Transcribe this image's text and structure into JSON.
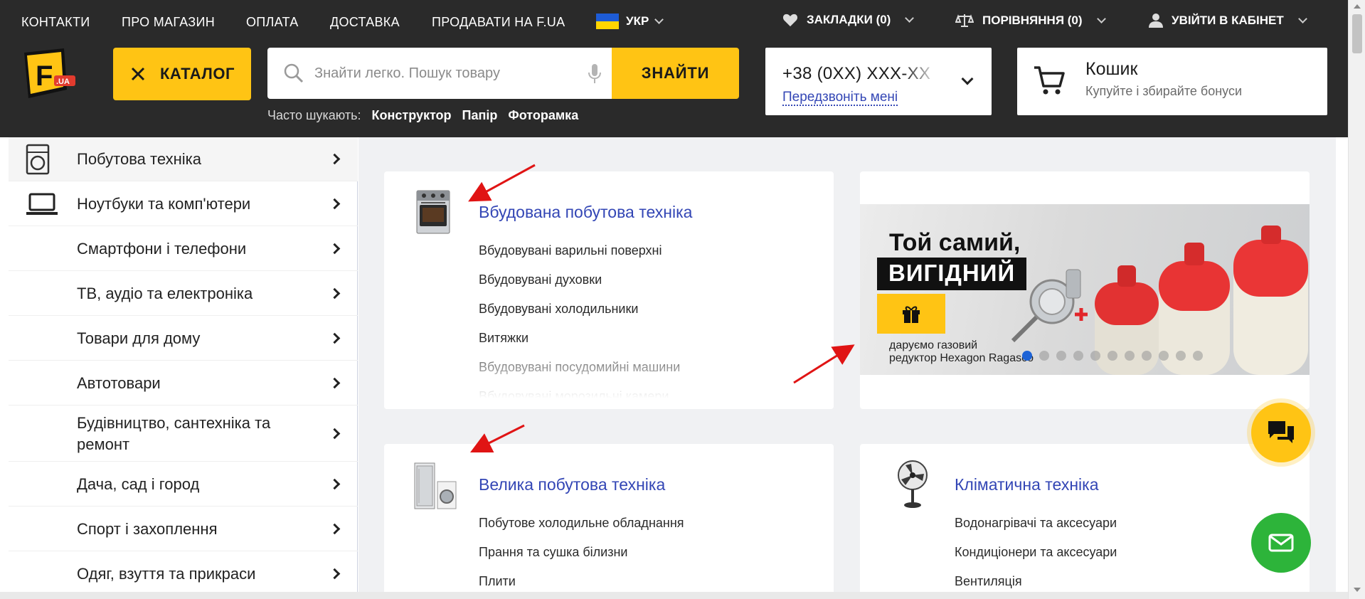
{
  "topnav": {
    "links": [
      "КОНТАКТИ",
      "ПРО МАГАЗИН",
      "ОПЛАТА",
      "ДОСТАВКА",
      "ПРОДАВАТИ НА F.UA"
    ],
    "language": "УКР",
    "bookmarks": "ЗАКЛАДКИ (0)",
    "compare": "ПОРІВНЯННЯ (0)",
    "account": "УВІЙТИ В КАБІНЕТ"
  },
  "logo": {
    "text": "F",
    "badge": ".UA"
  },
  "catalog_button": "КАТАЛОГ",
  "search": {
    "placeholder": "Знайти легко. Пошук товару",
    "button": "ЗНАЙТИ",
    "popular_label": "Часто шукають:",
    "popular_tags": [
      "Конструктор",
      "Папір",
      "Фоторамка"
    ]
  },
  "phone": {
    "number": "+38 (0XX) XXX-XX",
    "callback": "Передзвоніть мені"
  },
  "cart": {
    "title": "Кошик",
    "subtitle": "Купуйте і збирайте бонуси"
  },
  "sidebar": {
    "items": [
      {
        "label": "Побутова техніка",
        "icon": "washing-machine-icon"
      },
      {
        "label": "Ноутбуки та комп'ютери",
        "icon": "laptop-icon"
      },
      {
        "label": "Смартфони і телефони"
      },
      {
        "label": "ТВ, аудіо та електроніка"
      },
      {
        "label": "Товари для дому"
      },
      {
        "label": "Автотовари"
      },
      {
        "label": "Будівництво, сантехніка та ремонт"
      },
      {
        "label": "Дача, сад і город"
      },
      {
        "label": "Спорт і захоплення"
      },
      {
        "label": "Одяг, взуття та прикраси"
      }
    ]
  },
  "cards": {
    "builtin": {
      "title": "Вбудована побутова техніка",
      "items": [
        "Вбудовувані варильні поверхні",
        "Вбудовувані духовки",
        "Вбудовувані холодильники",
        "Витяжки",
        "Вбудовувані посудомийні машини",
        "Вбудовувані морозильні камери"
      ]
    },
    "large": {
      "title": "Велика побутова техніка",
      "items": [
        "Побутове холодильне обладнання",
        "Прання та сушка білизни",
        "Плити"
      ]
    },
    "climate": {
      "title": "Кліматична техніка",
      "items": [
        "Водонагрівачі та аксесуари",
        "Кондиціонери та аксесуари",
        "Вентиляція"
      ]
    }
  },
  "banner": {
    "line1": "Той самий,",
    "line2": "ВИГІДНИЙ",
    "sub1": "даруємо газовий",
    "sub2": "редуктор Hexagon Ragasco",
    "slides": 11,
    "active_slide": 1
  },
  "colors": {
    "accent": "#ffc414",
    "link": "#3346b5",
    "header": "#2a2a2a",
    "annotation": "#e01414",
    "mail": "#2db43a"
  }
}
